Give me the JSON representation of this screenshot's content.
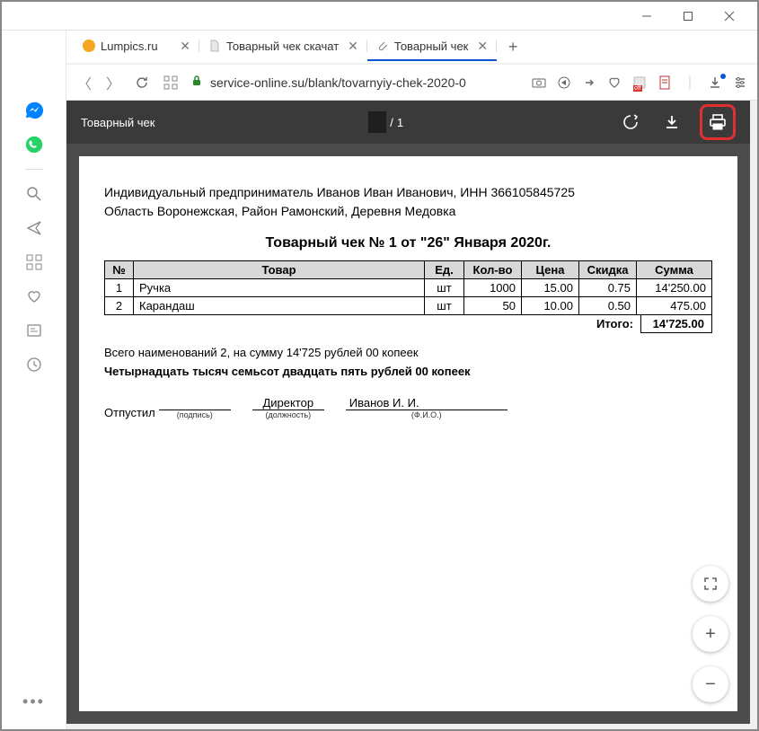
{
  "window": {
    "minimize": "—",
    "maximize": "▢",
    "close": "✕"
  },
  "tabs": [
    {
      "title": "Lumpics.ru",
      "icon_color": "#f5a623"
    },
    {
      "title": "Товарный чек скачат",
      "icon_color": "#c9d4e0"
    },
    {
      "title": "Товарный чек",
      "icon_color": "#c9d4e0",
      "active": true
    }
  ],
  "newtab": "+",
  "address": {
    "url": "service-online.su/blank/tovarnyiy-chek-2020-0"
  },
  "pdf": {
    "title": "Товарный чек",
    "page_current": "",
    "page_total": "1",
    "page_sep": "/"
  },
  "doc": {
    "line1": "Индивидуальный предприниматель Иванов Иван Иванович, ИНН 366105845725",
    "line2": "Область Воронежская, Район Рамонский, Деревня Медовка",
    "title": "Товарный чек № 1 от \"26\" Января 2020г.",
    "headers": {
      "no": "№",
      "item": "Товар",
      "unit": "Ед.",
      "qty": "Кол-во",
      "price": "Цена",
      "discount": "Скидка",
      "sum": "Сумма"
    },
    "rows": [
      {
        "no": "1",
        "item": "Ручка",
        "unit": "шт",
        "qty": "1000",
        "price": "15.00",
        "discount": "0.75",
        "sum": "14'250.00"
      },
      {
        "no": "2",
        "item": "Карандаш",
        "unit": "шт",
        "qty": "50",
        "price": "10.00",
        "discount": "0.50",
        "sum": "475.00"
      }
    ],
    "total_label": "Итого:",
    "total_value": "14'725.00",
    "summary": "Всего наименований 2, на сумму 14'725 рублей 00 копеек",
    "words": "Четырнадцать тысяч семьсот двадцать пять рублей 00 копеек",
    "sign": {
      "released": "Отпустил",
      "sig_caption": "(подпись)",
      "position": "Директор",
      "pos_caption": "(должность)",
      "fio": "Иванов И. И.",
      "fio_caption": "(Ф.И.О.)"
    }
  },
  "zoom": {
    "fit": "⛶",
    "in": "+",
    "out": "−"
  }
}
